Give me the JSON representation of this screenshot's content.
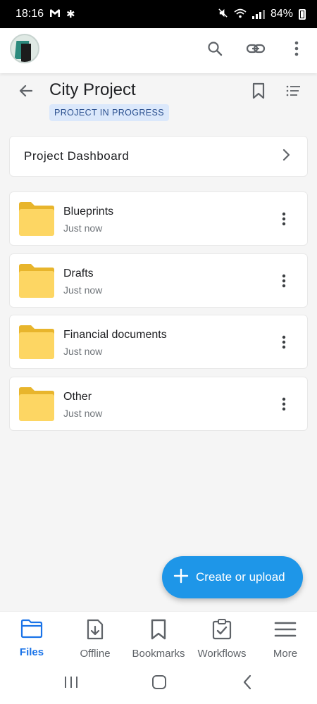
{
  "status_bar": {
    "time": "18:16",
    "notif_icons": [
      "gmail-icon",
      "asterisk-icon"
    ],
    "battery": "84%"
  },
  "app_bar": {
    "icons": [
      "search-icon",
      "link-icon",
      "more-vertical-icon"
    ]
  },
  "header": {
    "title": "City Project",
    "badge": "PROJECT IN PROGRESS"
  },
  "dashboard": {
    "label": "Project Dashboard"
  },
  "folders": [
    {
      "name": "Blueprints",
      "date": "Just now"
    },
    {
      "name": "Drafts",
      "date": "Just now"
    },
    {
      "name": "Financial documents",
      "date": "Just now"
    },
    {
      "name": "Other",
      "date": "Just now"
    }
  ],
  "fab": {
    "label": "Create or upload"
  },
  "bottom_nav": [
    {
      "label": "Files",
      "icon": "folder-icon",
      "active": true
    },
    {
      "label": "Offline",
      "icon": "offline-download-icon",
      "active": false
    },
    {
      "label": "Bookmarks",
      "icon": "bookmark-icon",
      "active": false
    },
    {
      "label": "Workflows",
      "icon": "clipboard-check-icon",
      "active": false
    },
    {
      "label": "More",
      "icon": "menu-icon",
      "active": false
    }
  ],
  "colors": {
    "accent": "#1a73e8",
    "fab": "#1e96e8",
    "folder": "#fdd663",
    "badge_bg": "#dbe8fb",
    "badge_text": "#2a4f8e"
  }
}
